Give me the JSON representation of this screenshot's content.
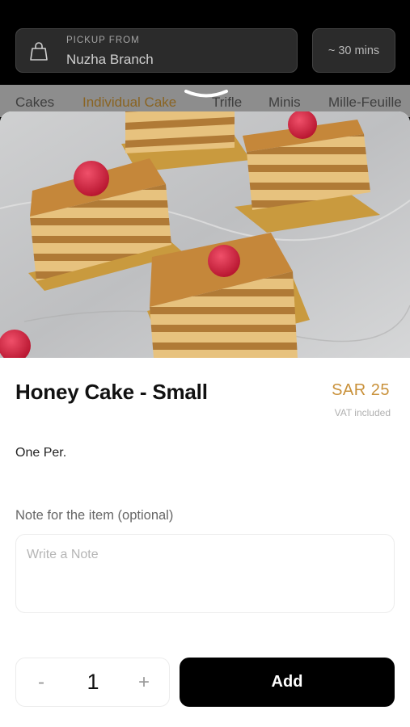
{
  "header": {
    "pickup_label": "PICKUP FROM",
    "branch_name": "Nuzha Branch",
    "eta": "~ 30 mins"
  },
  "categories": [
    "Cakes",
    "Individual Cake",
    "Trifle",
    "Minis",
    "Mille-Feuille"
  ],
  "active_category": "Individual Cake",
  "product": {
    "name": "Honey Cake - Small",
    "price": "SAR 25",
    "vat_note": "VAT included",
    "description": "One Per.",
    "image_icon": "honey-cake-photo"
  },
  "note": {
    "label": "Note for the item (optional)",
    "placeholder": "Write a Note",
    "value": ""
  },
  "quantity": {
    "minus": "-",
    "value": "1",
    "plus": "+"
  },
  "actions": {
    "add_label": "Add"
  },
  "colors": {
    "accent": "#c9913a",
    "active_tab": "#8a6422",
    "primary_button": "#000000"
  }
}
